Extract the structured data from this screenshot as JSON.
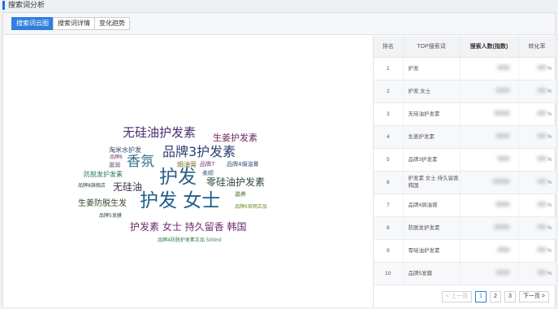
{
  "page": {
    "title": "搜索词分析"
  },
  "tabs": [
    {
      "label": "搜索词云图",
      "active": true
    },
    {
      "label": "搜索词详情",
      "active": false
    },
    {
      "label": "变化趋势",
      "active": false
    }
  ],
  "cloud": {
    "words": [
      {
        "text": "无硅油护发素",
        "color": "#4a2f6e"
      },
      {
        "text": "生姜护发素",
        "color": "#6b2a5e"
      },
      {
        "text": "淘米水护发",
        "color": "#2f4a6b"
      },
      {
        "text": "品牌3护发素",
        "color": "#2d3f73"
      },
      {
        "text": "品牌8",
        "color": "#7a3a6e"
      },
      {
        "text": "香氛",
        "color": "#2f6f8f"
      },
      {
        "text": "焗油膏",
        "color": "#6b6e1f"
      },
      {
        "text": "品牌7",
        "color": "#6e3a6e"
      },
      {
        "text": "品牌4焗油膏",
        "color": "#3a4a7a"
      },
      {
        "text": "滋润",
        "color": "#5a3a6e"
      },
      {
        "text": "防脱发护发素",
        "color": "#2f7a5a"
      },
      {
        "text": "柔顺",
        "color": "#3a5a8a"
      },
      {
        "text": "护发",
        "color": "#2a5f8a"
      },
      {
        "text": "零硅油护发素",
        "color": "#2f4a3a"
      },
      {
        "text": "品牌8旗舰店",
        "color": "#2f4a4a"
      },
      {
        "text": "无硅油",
        "color": "#3a2f4a"
      },
      {
        "text": "护发 女士",
        "color": "#1f5f8a"
      },
      {
        "text": "滋养",
        "color": "#3a6e2f"
      },
      {
        "text": "生姜防脱生发",
        "color": "#3a4a2f"
      },
      {
        "text": "品牌6官网正品",
        "color": "#6e8a1f"
      },
      {
        "text": "品牌5发膜",
        "color": "#2f4a5a"
      },
      {
        "text": "护发素 女士 持久留香 韩国",
        "color": "#6e2a6e"
      },
      {
        "text": "品牌4防脱护发素正品 500ml",
        "color": "#2f7a3a"
      }
    ]
  },
  "table": {
    "headers": [
      "排名",
      "TOP搜索词",
      "搜索人数(指数)",
      "转化率"
    ],
    "rows": [
      {
        "rank": "1",
        "keyword": "护发"
      },
      {
        "rank": "2",
        "keyword": "护发 女士"
      },
      {
        "rank": "3",
        "keyword": "无硅油护发素"
      },
      {
        "rank": "4",
        "keyword": "生姜护发素"
      },
      {
        "rank": "5",
        "keyword": "品牌3护发素"
      },
      {
        "rank": "6",
        "keyword": "护发素 女士 持久留香 韩国"
      },
      {
        "rank": "7",
        "keyword": "品牌4焗油膏"
      },
      {
        "rank": "8",
        "keyword": "防脱发护发素"
      },
      {
        "rank": "9",
        "keyword": "零硅油护发素"
      },
      {
        "rank": "10",
        "keyword": "品牌5发膜"
      }
    ],
    "rate_suffix": "%"
  },
  "pagination": {
    "prev": "< 上一页",
    "pages": [
      "1",
      "2",
      "3"
    ],
    "current": "1",
    "next": "下一页 >"
  }
}
